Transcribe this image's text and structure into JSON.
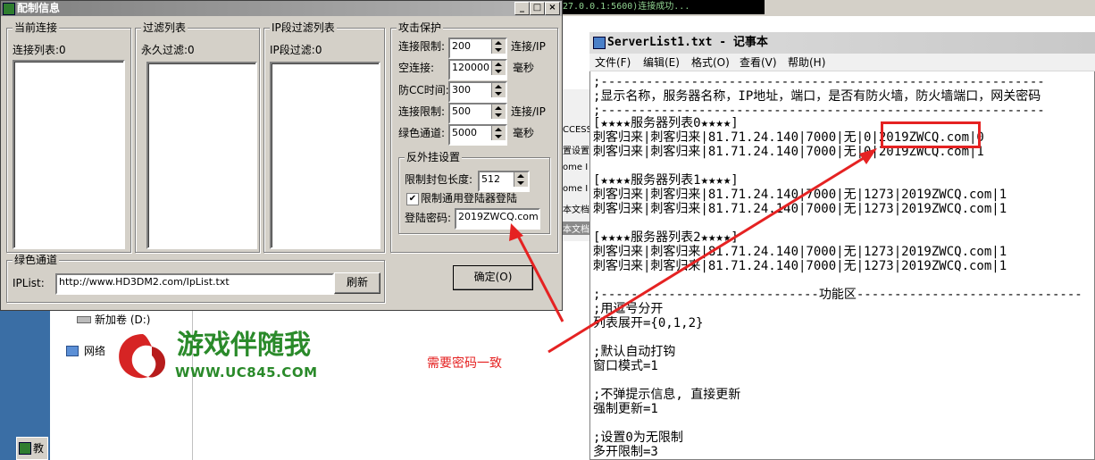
{
  "console": {
    "text": "27.0.0.1:5600)连接成功..."
  },
  "dialog": {
    "title": "配制信息",
    "titlebar_buttons": [
      "_",
      "□",
      "×"
    ],
    "groups": {
      "current": {
        "title": "当前连接",
        "label": "连接列表:0"
      },
      "filter": {
        "title": "过滤列表",
        "label": "永久过滤:0"
      },
      "ipfilter": {
        "title": "IP段过滤列表",
        "label": "IP段过滤:0"
      },
      "attack": {
        "title": "攻击保护",
        "rows": [
          {
            "label": "连接限制:",
            "value": "200",
            "unit": "连接/IP"
          },
          {
            "label": "空连接:",
            "value": "120000",
            "unit": "毫秒"
          },
          {
            "label": "防CC时间:",
            "value": "300",
            "unit": ""
          },
          {
            "label": "连接限制:",
            "value": "500",
            "unit": "连接/IP"
          },
          {
            "label": "绿色通道:",
            "value": "5000",
            "unit": "毫秒"
          }
        ]
      },
      "anticheat": {
        "title": "反外挂设置",
        "packet_label": "限制封包长度:",
        "packet_value": "512",
        "checkbox_label": "限制通用登陆器登陆",
        "checkbox_checked": true,
        "password_label": "登陆密码:",
        "password_value": "2019ZWCQ.com"
      },
      "green": {
        "title": "绿色通道",
        "iplist_label": "IPList:",
        "iplist_value": "http://www.HD3DM2.com/IpList.txt",
        "refresh_label": "刷新"
      }
    },
    "ok_label": "确定(O)"
  },
  "explorer": {
    "items": [
      {
        "label": "新加卷 (D:)"
      },
      {
        "label": "网络"
      }
    ]
  },
  "mid_window": {
    "texts": [
      "CCESS",
      "置设置",
      "ome I",
      "ome I",
      "本文档",
      "本文档"
    ]
  },
  "notepad": {
    "title": "ServerList1.txt - 记事本",
    "menu": [
      "文件(F)",
      "编辑(E)",
      "格式(O)",
      "查看(V)",
      "帮助(H)"
    ],
    "lines": [
      ";-----------------------------------------------------------",
      ";显示名称，服务器名称，IP地址，端口，是否有防火墙，防火墙端口，网关密码",
      ";-----------------------------------------------------------",
      "[★★★★服务器列表0★★★★]",
      "刺客归来|刺客归来|81.71.24.140|7000|无|0|2019ZWCQ.com|0",
      "刺客归来|刺客归来|81.71.24.140|7000|无|0|2019ZWCQ.com|1",
      "",
      "[★★★★服务器列表1★★★★]",
      "刺客归来|刺客归来|81.71.24.140|7000|无|1273|2019ZWCQ.com|1",
      "刺客归来|刺客归来|81.71.24.140|7000|无|1273|2019ZWCQ.com|1",
      "",
      "[★★★★服务器列表2★★★★]",
      "刺客归来|刺客归来|81.71.24.140|7000|无|1273|2019ZWCQ.com|1",
      "刺客归来|刺客归来|81.71.24.140|7000|无|1273|2019ZWCQ.com|1",
      "",
      ";-----------------------------功能区------------------------------",
      ";用逗号分开",
      "列表展开={0,1,2}",
      "",
      ";默认自动打钩",
      "窗口模式=1",
      "",
      ";不弹提示信息, 直接更新",
      "强制更新=1",
      "",
      ";设置0为无限制",
      "多开限制=3"
    ]
  },
  "annotation": {
    "note": "需要密码一致",
    "color": "#e52222"
  },
  "watermark": {
    "title": "游戏伴随我",
    "url": "WWW.UC845.COM",
    "color": "#2a8a2a"
  },
  "taskbar": {
    "label": "教"
  }
}
